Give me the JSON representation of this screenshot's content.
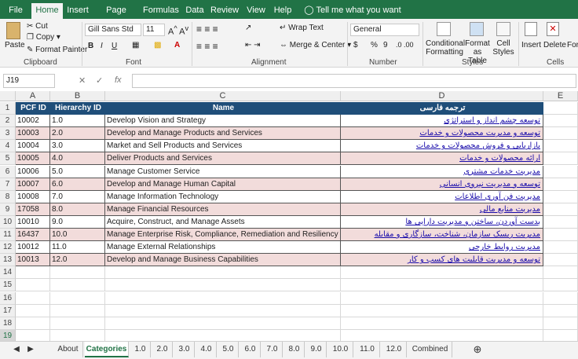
{
  "ribbon_tabs": [
    "File",
    "Home",
    "Insert",
    "Page Layout",
    "Formulas",
    "Data",
    "Review",
    "View",
    "Help"
  ],
  "tell_me": "Tell me what you want to do",
  "clipboard": {
    "paste": "Paste",
    "cut": "Cut",
    "copy": "Copy",
    "format_painter": "Format Painter",
    "label": "Clipboard"
  },
  "font": {
    "name": "Gill Sans Std",
    "size": "11",
    "bold": "B",
    "italic": "I",
    "underline": "U",
    "font_color_letter": "A",
    "label": "Font"
  },
  "alignment": {
    "wrap_text": "Wrap Text",
    "merge_center": "Merge & Center",
    "label": "Alignment"
  },
  "number": {
    "format": "General",
    "currency": "$",
    "percent": "%",
    "comma": "9",
    "label": "Number"
  },
  "styles": {
    "conditional_formatting": "Conditional Formatting",
    "format_as_table": "Format as Table",
    "cell_styles": "Cell Styles",
    "label": "Styles"
  },
  "cells": {
    "insert": "Insert",
    "delete": "Delete",
    "format": "Form",
    "label": "Cells"
  },
  "formula_bar": {
    "name_box": "J19",
    "fx": "fx",
    "formula": ""
  },
  "columns": [
    "A",
    "B",
    "C",
    "D",
    "E"
  ],
  "header_row": {
    "a": "PCF ID",
    "b": "Hierarchy ID",
    "c": "Name",
    "d": "ترجمه فارسی"
  },
  "rows": [
    {
      "a": "10002",
      "b": "1.0",
      "c": "Develop Vision and Strategy",
      "d": "توسعه چشم انداز و استراتژی"
    },
    {
      "a": "10003",
      "b": "2.0",
      "c": "Develop and Manage Products and Services",
      "d": "توسعه و مدیریت محصولات و خدمات"
    },
    {
      "a": "10004",
      "b": "3.0",
      "c": "Market and Sell Products and Services",
      "d": "بازاریابی و فروش محصولات و خدمات"
    },
    {
      "a": "10005",
      "b": "4.0",
      "c": "Deliver Products and Services",
      "d": "ارائه محصولات و خدمات"
    },
    {
      "a": "10006",
      "b": "5.0",
      "c": "Manage Customer Service",
      "d": "مدیریت خدمات مشتری"
    },
    {
      "a": "10007",
      "b": "6.0",
      "c": "Develop and Manage Human Capital",
      "d": "توسعه و مدیریت نیروی انسانی"
    },
    {
      "a": "10008",
      "b": "7.0",
      "c": "Manage Information Technology",
      "d": "مدیریت فن آوری اطلاعات"
    },
    {
      "a": "17058",
      "b": "8.0",
      "c": "Manage Financial Resources",
      "d": "مدیریت منابع مالی"
    },
    {
      "a": "10010",
      "b": "9.0",
      "c": "Acquire, Construct, and Manage Assets",
      "d": "بدست آوردن، ساختن و مدیریت دارایی ها"
    },
    {
      "a": "16437",
      "b": "10.0",
      "c": "Manage Enterprise Risk, Compliance, Remediation and Resiliency",
      "d": "مدیریت ریسک سازمان، شناخت، سازگاری و مقابله"
    },
    {
      "a": "10012",
      "b": "11.0",
      "c": "Manage External Relationships",
      "d": "مدیریت روابط خارجی"
    },
    {
      "a": "10013",
      "b": "12.0",
      "c": "Develop and Manage Business Capabilities",
      "d": "توسعه و مدیریت قابلیت های کسب و کار"
    }
  ],
  "row_numbers": [
    "1",
    "2",
    "3",
    "4",
    "5",
    "6",
    "7",
    "8",
    "9",
    "10",
    "11",
    "12",
    "13",
    "14",
    "15",
    "16",
    "17",
    "18",
    "19"
  ],
  "sheet_tabs": [
    "About",
    "Categories",
    "1.0",
    "2.0",
    "3.0",
    "4.0",
    "5.0",
    "6.0",
    "7.0",
    "8.0",
    "9.0",
    "10.0",
    "11.0",
    "12.0",
    "Combined"
  ],
  "active_sheet": "Categories",
  "colors": {
    "excel_green": "#217346",
    "header_blue": "#1f4e79",
    "pink_row": "#f2dcdb",
    "link_blue": "#1a0dab"
  }
}
